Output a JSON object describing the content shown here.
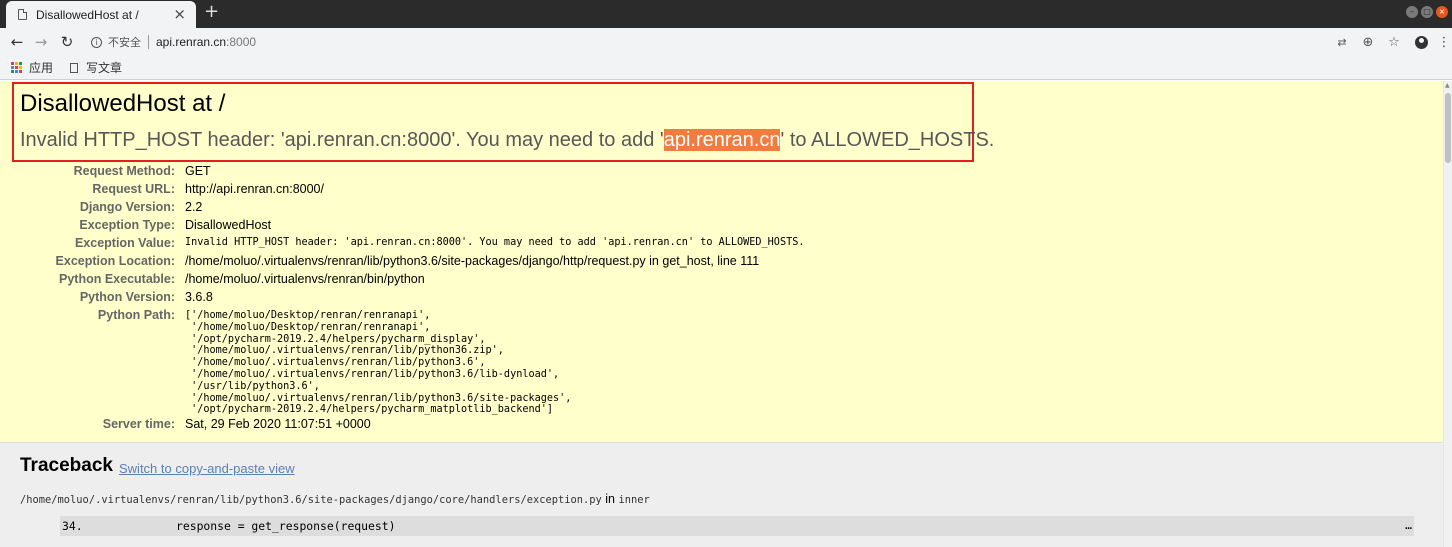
{
  "browser": {
    "tab_title": "DisallowedHost at /",
    "tab_close": "×",
    "new_tab": "+",
    "insecure_label": "不安全",
    "url_host": "api.renran.cn",
    "url_port": ":8000",
    "back": "←",
    "forward": "→",
    "reload": "↻",
    "bookmarks": {
      "apps_label": "应用",
      "item_label": "写文章"
    }
  },
  "error": {
    "title": "DisallowedHost at /",
    "message_before": "Invalid HTTP_HOST header: 'api.renran.cn:8000'. You may need to add '",
    "message_highlight": "api.renran.cn",
    "message_after": "' to ALLOWED_HOSTS."
  },
  "meta": {
    "request_method_label": "Request Method:",
    "request_method": "GET",
    "request_url_label": "Request URL:",
    "request_url": "http://api.renran.cn:8000/",
    "django_version_label": "Django Version:",
    "django_version": "2.2",
    "exception_type_label": "Exception Type:",
    "exception_type": "DisallowedHost",
    "exception_value_label": "Exception Value:",
    "exception_value": "Invalid HTTP_HOST header: 'api.renran.cn:8000'. You may need to add 'api.renran.cn' to ALLOWED_HOSTS.",
    "exception_location_label": "Exception Location:",
    "exception_location": "/home/moluo/.virtualenvs/renran/lib/python3.6/site-packages/django/http/request.py in get_host, line 111",
    "python_executable_label": "Python Executable:",
    "python_executable": "/home/moluo/.virtualenvs/renran/bin/python",
    "python_version_label": "Python Version:",
    "python_version": "3.6.8",
    "python_path_label": "Python Path:",
    "python_path": "['/home/moluo/Desktop/renran/renranapi',\n '/home/moluo/Desktop/renran/renranapi',\n '/opt/pycharm-2019.2.4/helpers/pycharm_display',\n '/home/moluo/.virtualenvs/renran/lib/python36.zip',\n '/home/moluo/.virtualenvs/renran/lib/python3.6',\n '/home/moluo/.virtualenvs/renran/lib/python3.6/lib-dynload',\n '/usr/lib/python3.6',\n '/home/moluo/.virtualenvs/renran/lib/python3.6/site-packages',\n '/opt/pycharm-2019.2.4/helpers/pycharm_matplotlib_backend']",
    "server_time_label": "Server time:",
    "server_time": "Sat, 29 Feb 2020 11:07:51 +0000"
  },
  "traceback": {
    "heading": "Traceback",
    "switch_link": "Switch to copy-and-paste view",
    "file_path": "/home/moluo/.virtualenvs/renran/lib/python3.6/site-packages/django/core/handlers/exception.py",
    "file_in": "in",
    "file_func": "inner",
    "line_number": "34.",
    "line_code": "response = get_response(request)",
    "ellipsis": "…"
  },
  "colors": {
    "summary_bg": "#ffffcc",
    "highlight_border": "#e02020",
    "selection_bg": "#f07c3e",
    "traceback_bg": "#eeeeee",
    "link": "#5b80b2"
  },
  "icons": {
    "apps_grid_colors": [
      "#db4437",
      "#f4b400",
      "#0f9d58",
      "#4285f4",
      "#db4437",
      "#f4b400",
      "#0f9d58",
      "#4285f4",
      "#db4437"
    ]
  }
}
